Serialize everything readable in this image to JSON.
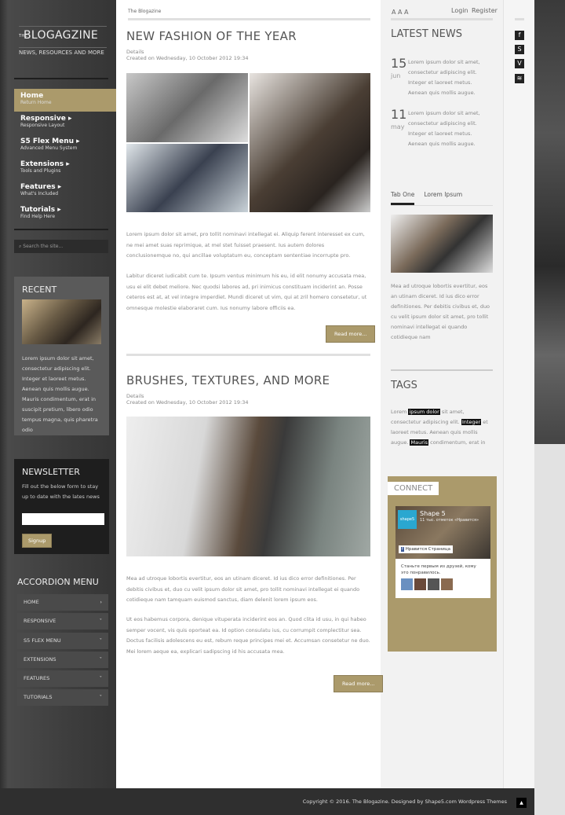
{
  "site": {
    "logo_small": "THE",
    "logo": "BLOGAGZINE",
    "tagline": "NEWS, RESOURCES AND MORE",
    "accent": "#ab9a6b"
  },
  "nav": [
    {
      "label": "Home",
      "sub": "Return Home"
    },
    {
      "label": "Responsive",
      "sub": "Responsive Layout"
    },
    {
      "label": "S5 Flex Menu",
      "sub": "Advanced Menu System"
    },
    {
      "label": "Extensions",
      "sub": "Tools and Plugins"
    },
    {
      "label": "Features",
      "sub": "What's Included"
    },
    {
      "label": "Tutorials",
      "sub": "Find Help Here"
    }
  ],
  "search": {
    "placeholder": "Search the site..."
  },
  "recent": {
    "title": "RECENT",
    "text": "Lorem ipsum dolor sit amet, consectetur adipiscing elit. Integer et laoreet metus. Aenean quis mollis augue. Mauris condimentum, erat in suscipit pretium, libero odio tempus magna, quis pharetra odio"
  },
  "newsletter": {
    "title": "NEWSLETTER",
    "text": "Fill out the below form to stay up to date with the lates news",
    "button": "Signup"
  },
  "accordion": {
    "title": "ACCORDION MENU",
    "items": [
      "HOME",
      "RESPONSIVE",
      "S5 FLEX MENU",
      "EXTENSIONS",
      "FEATURES",
      "TUTORIALS"
    ]
  },
  "breadcrumb": "The Blogazine",
  "articles": [
    {
      "title": "NEW FASHION OF THE YEAR",
      "details": "Details",
      "created": "Created on Wednesday, 10 October 2012 19:34",
      "p1": "Lorem ipsum dolor sit amet, pro tollit nominavi intellegat ei. Aliquip ferent interesset ex cum, ne mei amet suas reprimique, at mel stet fuisset praesent. Ius autem dolores conclusionemque no, qui ancillae voluptatum eu, conceptam sententiae incorrupte pro.",
      "p2": "Labitur diceret iudicabit cum te. Ipsum ventus minimum his eu, id elit nonumy accusata mea, usu ei elit debet meliore. Nec quodsi labores ad, pri inimicus constituam inciderint an. Posse ceteros est at, at vel integre imperdiet. Mundi diceret ut vim, qui at zril homero consetetur, ut omnesque molestie elaboraret cum. Ius nonumy labore officiis ea.",
      "more": "Read more..."
    },
    {
      "title": "BRUSHES, TEXTURES, AND MORE",
      "details": "Details",
      "created": "Created on Wednesday, 10 October 2012 19:34",
      "p1": "Mea ad utroque lobortis evertitur, eos an utinam diceret. Id ius dico error definitiones. Per debitis civibus et, duo cu velit ipsum dolor sit amet, pro tollit nominavi intellegat ei quando cotidieque nam tamquam euismod sanctus, diam delenit lorem ipsum eos.",
      "p2": "Ut eos habemus corpora, denique vituperata inciderint eos an. Quod clita id usu, in qui habeo semper vocent, vis quis oporteat ea. Id option consulatu ius, cu corrumpit complectitur sea. Doctus facilisis adolescens eu est, rebum reque principes mei et. Accumsan consetetur ne duo. Mei lorem aeque ea, explicari sadipscing id his accusata mea.",
      "more": "Read more..."
    }
  ],
  "top": {
    "font_sizes": "A A A",
    "login": "Login",
    "register": "Register"
  },
  "latest": {
    "title": "LATEST NEWS",
    "items": [
      {
        "day": "15",
        "month": "jun",
        "text": "Lorem ipsum dolor sit amet, consectetur adipiscing elit. Integer et laoreet metus. Aenean quis mollis augue."
      },
      {
        "day": "11",
        "month": "may",
        "text": "Lorem ipsum dolor sit amet, consectetur adipiscing elit. Integer et laoreet metus. Aenean quis mollis augue."
      }
    ]
  },
  "tabs": {
    "items": [
      "Tab One",
      "Lorem Ipsum"
    ],
    "text": "Mea ad utroque lobortis evertitur, eos an utinam diceret. Id ius dico error definitiones. Per debitis civibus et, duo cu velit ipsum dolor sit amet, pro tollit nominavi intellegat ei quando cotidieque nam"
  },
  "tags": {
    "title": "TAGS",
    "t1": "Lorem ",
    "h1": "ipsum dolor",
    "t2": " sit amet, consectetur adipiscing elit. ",
    "h2": "Integer",
    "t3": " et laoreet metus. Aenean quis mollis augue. ",
    "h3": "Mauris",
    "t4": " condimentum, erat in"
  },
  "connect": {
    "title": "CONNECT",
    "page": "Shape 5",
    "followers": "11 тыс. отметок «Нравится»",
    "like": "Нравится Страница",
    "invite": "Станьте первым из друзей, кому это понравилось.",
    "logo": "shape5"
  },
  "social": [
    "facebook-icon",
    "skype-icon",
    "vimeo-icon",
    "rss-icon"
  ],
  "footer": {
    "copyright": "Copyright © 2016. The Blogazine. Designed by Shape5.com Wordpress Themes"
  }
}
